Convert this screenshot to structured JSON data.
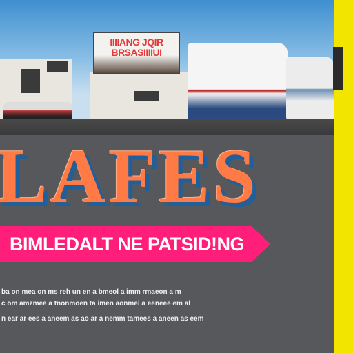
{
  "photo": {
    "sign_line1": "IIIIANG JQIR",
    "sign_line2": "BRSASIIIIUI"
  },
  "headline": "LAFES",
  "banner": {
    "text": "BIMLEDALT NE PATSID!NG",
    "color": "#ff1f7a"
  },
  "body_lines": [
    "ba on mea on ms reh un en a bmeol a imm rmaeon a m",
    "c om amzmee a tnonmoen ta imen aonmei a eeneee em al",
    "n ear ar ees a aneem as ao ar a nemm tamees a aneen as eem"
  ],
  "colors": {
    "accent_stripe": "#f2e600",
    "headline": "#ff7a45",
    "headline_shadow": "#1f5f9c",
    "background": "#57585c"
  }
}
